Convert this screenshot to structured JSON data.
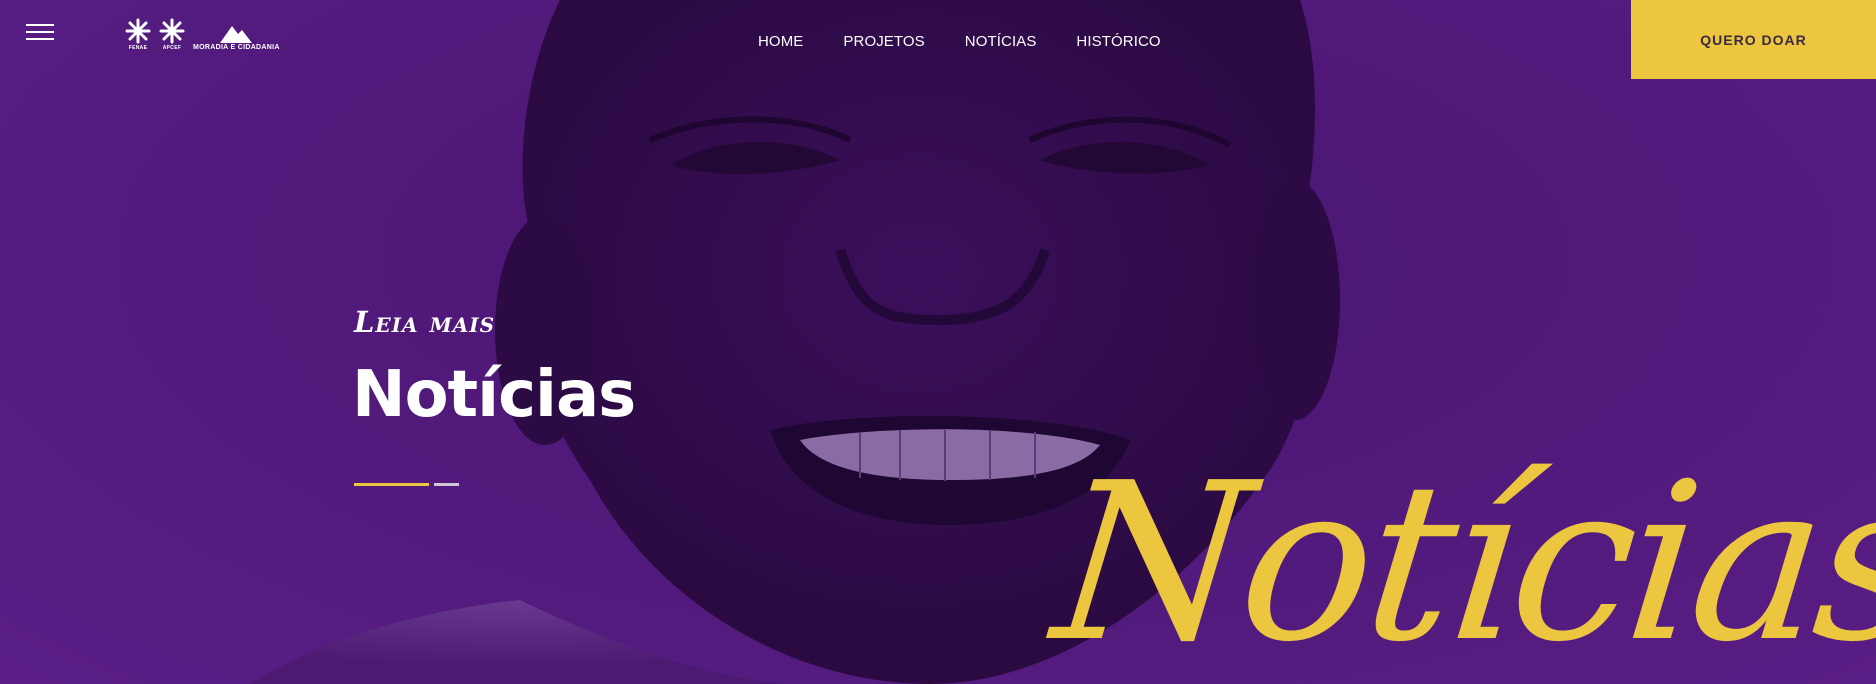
{
  "header": {
    "logos": [
      {
        "name": "FENAE"
      },
      {
        "name": "APCEF"
      },
      {
        "name": "MORADIA E CIDADANIA"
      }
    ],
    "nav": [
      "HOME",
      "PROJETOS",
      "NOTÍCIAS",
      "HISTÓRICO"
    ],
    "donate_label": "QUERO DOAR"
  },
  "hero": {
    "eyebrow": "Leia mais",
    "title": "Notícias",
    "script_word": "Notícias"
  },
  "colors": {
    "primary": "#521a7c",
    "accent": "#ecc63e",
    "text": "#ffffff"
  },
  "icons": [
    "hamburger-menu-icon"
  ]
}
